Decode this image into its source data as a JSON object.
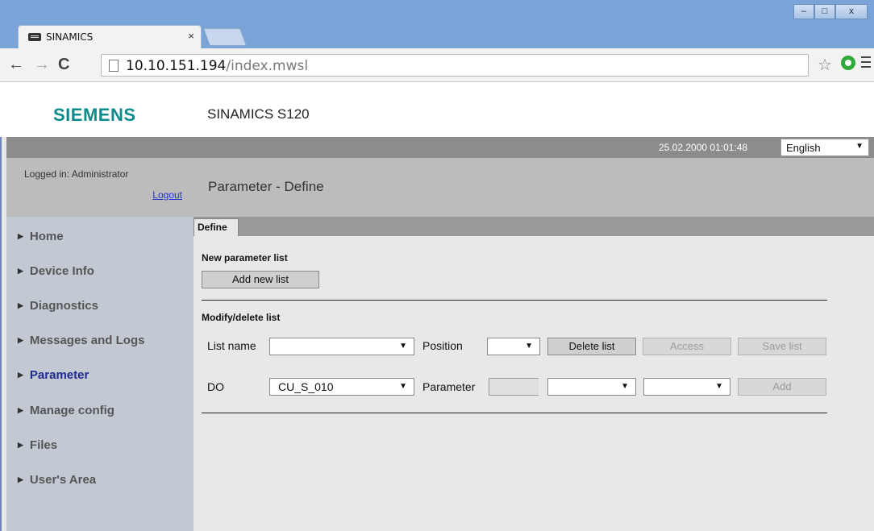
{
  "browser": {
    "tab_title": "SINAMICS",
    "tab_close": "×",
    "url_host": "10.10.151.194",
    "url_path": "/index.mwsl",
    "window_buttons": [
      "–",
      "□",
      "x"
    ]
  },
  "header": {
    "logo": "SIEMENS",
    "product": "SINAMICS S120",
    "datetime": "25.02.2000 01:01:48",
    "language": "English"
  },
  "user": {
    "logged_in": "Logged in: Administrator",
    "logout": "Logout"
  },
  "page_title": "Parameter - Define",
  "sidebar": {
    "items": [
      {
        "label": "Home"
      },
      {
        "label": "Device Info"
      },
      {
        "label": "Diagnostics"
      },
      {
        "label": "Messages and Logs"
      },
      {
        "label": "Parameter",
        "active": true
      },
      {
        "label": "Manage config"
      },
      {
        "label": "Files"
      },
      {
        "label": "User's Area"
      }
    ]
  },
  "content": {
    "tab": "Define",
    "new_list": {
      "title": "New parameter list",
      "add_button": "Add new list"
    },
    "modify": {
      "title": "Modify/delete list",
      "list_name_label": "List name",
      "list_name_value": "",
      "position_label": "Position",
      "position_value": "",
      "delete_button": "Delete list",
      "access_button": "Access",
      "save_button": "Save list",
      "do_label": "DO",
      "do_value": "CU_S_010",
      "parameter_label": "Parameter",
      "parameter_value": "",
      "index_select_value": "",
      "extra_select_value": "",
      "add_button": "Add"
    }
  }
}
